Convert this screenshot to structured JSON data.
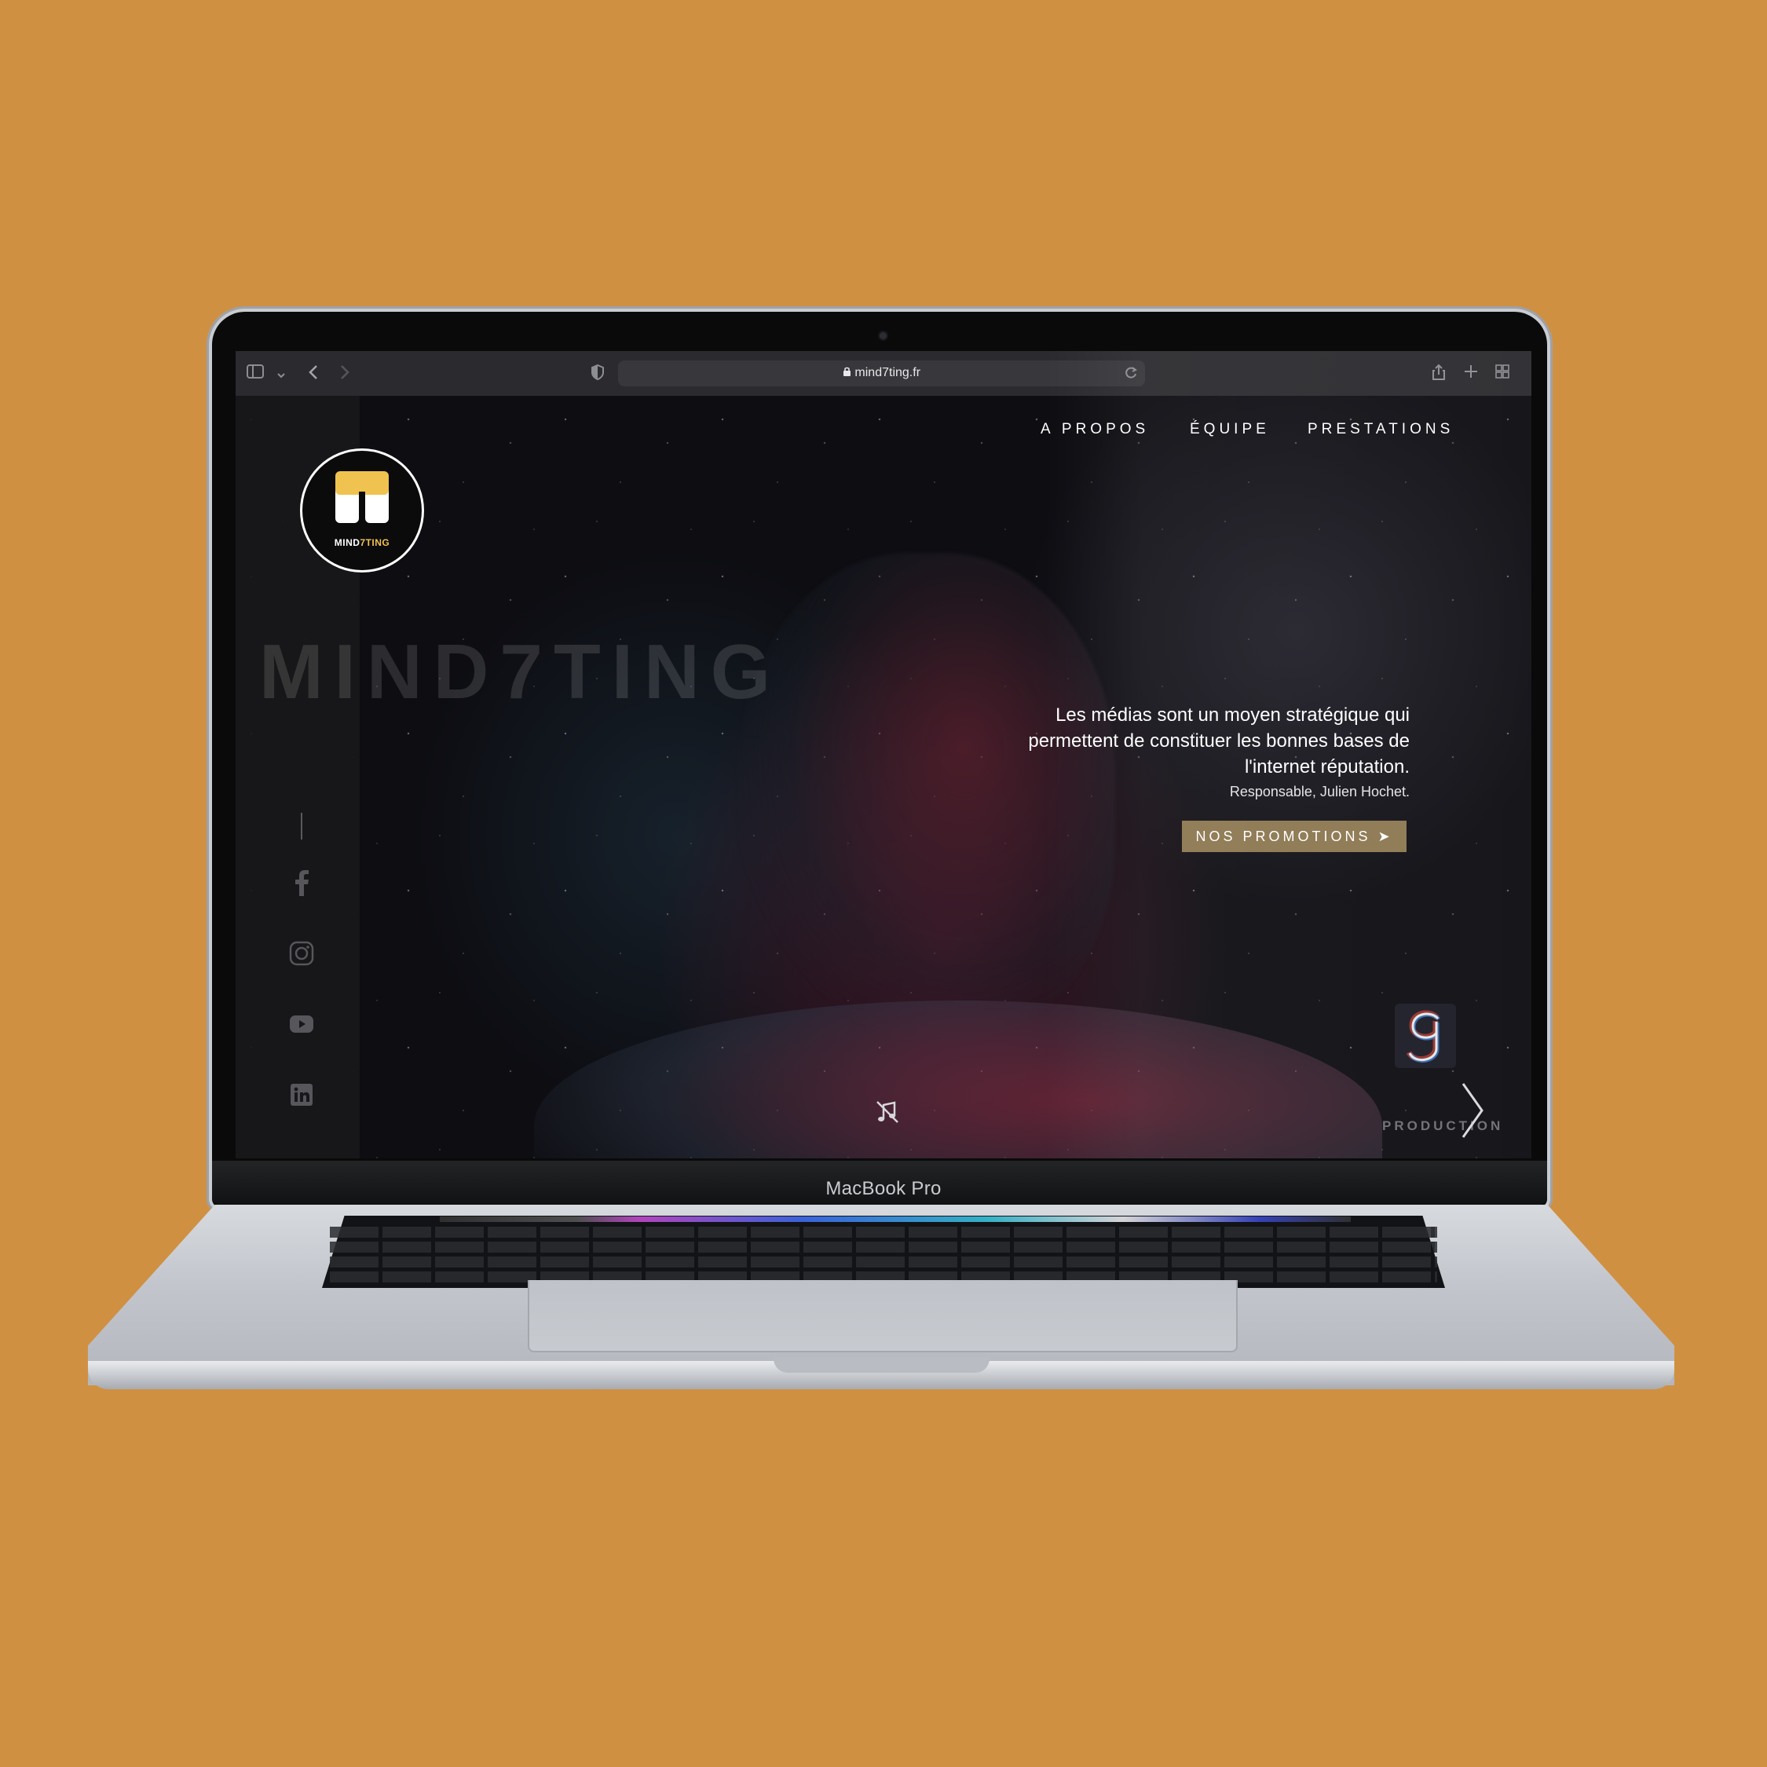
{
  "device": {
    "label": "MacBook Pro"
  },
  "browser": {
    "url": "mind7ting.fr",
    "icons": [
      "sidebar-icon",
      "chevron-down-icon",
      "back-arrow-icon",
      "forward-arrow-icon",
      "shield-icon",
      "lock-icon",
      "reload-icon",
      "share-icon",
      "new-tab-icon",
      "tabs-overview-icon"
    ]
  },
  "site": {
    "logo": {
      "text_white": "MIND",
      "text_gold": "7TING",
      "colors": {
        "gold": "#f0c24f",
        "white": "#ffffff"
      }
    },
    "brand_background_text": "MIND7TING",
    "nav": {
      "items": [
        "A PROPOS",
        "ÉQUIPE",
        "PRESTATIONS"
      ]
    },
    "hero": {
      "quote": "Les médias sont un moyen stratégique qui permettent de constituer les bonnes bases de l'internet réputation.",
      "author": "Responsable, Julien Hochet.",
      "cta_label": "NOS PROMOTIONS ➤",
      "cta_color": "#8c7750"
    },
    "social": {
      "icons": [
        "facebook-icon",
        "instagram-icon",
        "youtube-icon",
        "linkedin-icon"
      ]
    },
    "partner": {
      "subtitle": "PRODUCTION"
    },
    "controls": {
      "icons": [
        "music-off-icon",
        "next-slide-arrow-icon"
      ]
    }
  }
}
